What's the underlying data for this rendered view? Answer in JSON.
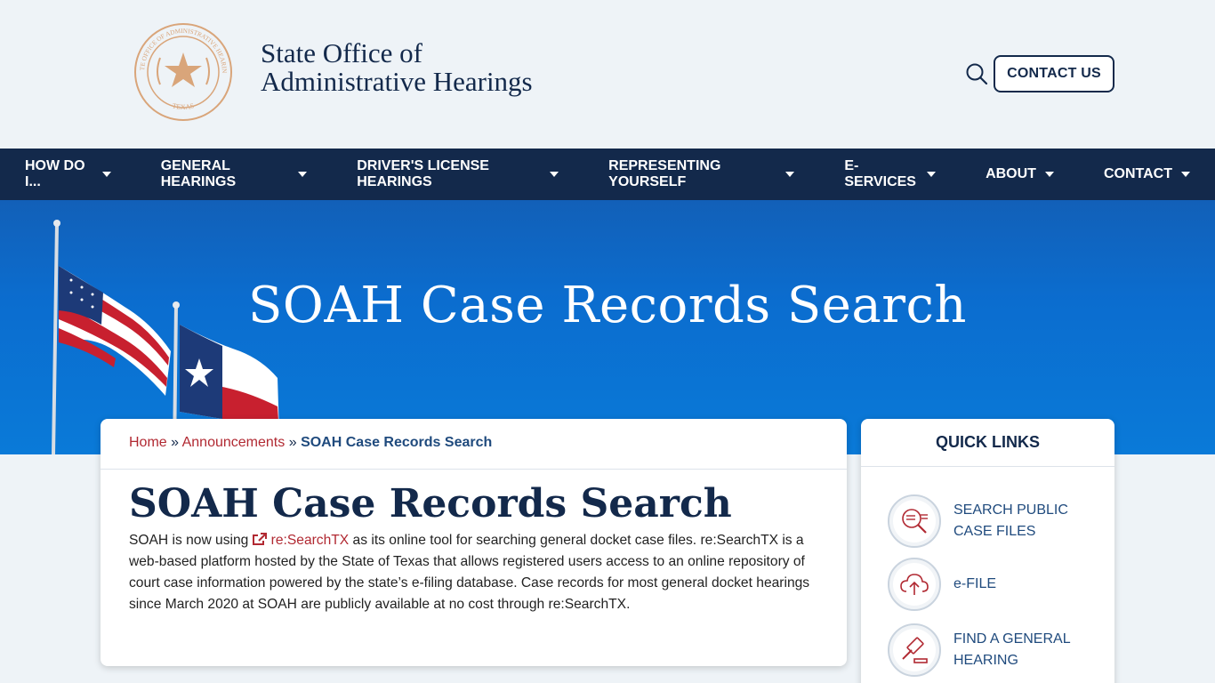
{
  "header": {
    "seal_text_top": "STATE OFFICE OF ADMINISTRATIVE HEARINGS",
    "seal_text_bottom": "TEXAS",
    "brand_line1": "State Office of",
    "brand_line2": "Administrative Hearings",
    "contact_label": "CONTACT US"
  },
  "nav": {
    "items": [
      {
        "label": "HOW DO I..."
      },
      {
        "label": "GENERAL HEARINGS"
      },
      {
        "label": "DRIVER'S LICENSE HEARINGS"
      },
      {
        "label": "REPRESENTING YOURSELF"
      },
      {
        "label": "E-SERVICES"
      },
      {
        "label": "ABOUT"
      },
      {
        "label": "CONTACT"
      }
    ]
  },
  "hero": {
    "title": "SOAH Case Records Search"
  },
  "breadcrumb": {
    "home": "Home",
    "sep": "»",
    "parent": "Announcements",
    "current": "SOAH Case Records Search"
  },
  "main": {
    "title": "SOAH Case Records Search",
    "para_part1": "SOAH is now using ",
    "link_text": "re:SearchTX",
    "para_part2": " as its online tool for searching general docket case files. re:SearchTX is a web-based platform hosted by the State of Texas that allows registered users access to an online repository of court case information powered by the state’s e-filing database.  Case records for most general docket hearings since March 2020 at SOAH are publicly available at no cost through re:SearchTX."
  },
  "quick_links": {
    "title": "QUICK LINKS",
    "items": [
      {
        "label": "SEARCH PUBLIC CASE FILES",
        "icon": "search-documents-icon"
      },
      {
        "label": "e-FILE",
        "icon": "cloud-upload-icon"
      },
      {
        "label": "FIND A GENERAL HEARING",
        "icon": "gavel-icon"
      }
    ]
  },
  "colors": {
    "navy": "#13294b",
    "red": "#b12932",
    "link_blue": "#1f4a7d",
    "seal": "#d9a57a"
  }
}
